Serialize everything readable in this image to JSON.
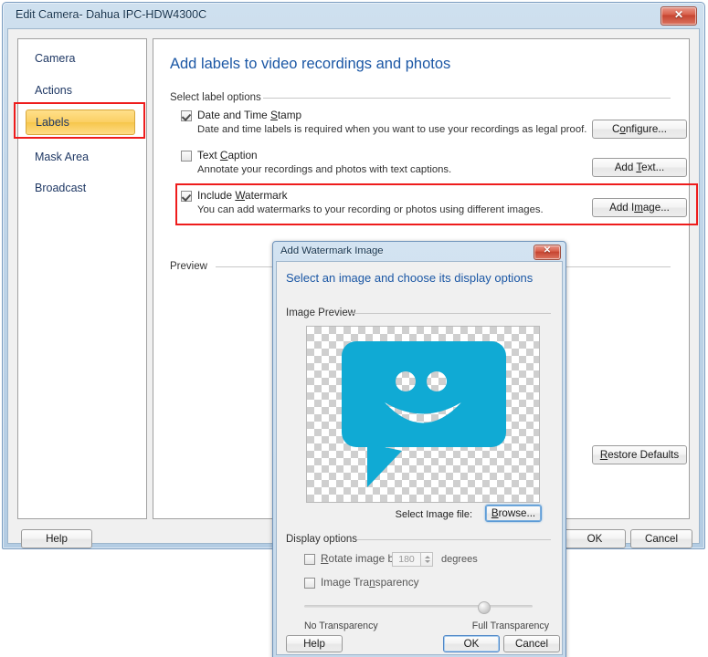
{
  "outer_window": {
    "title": "Edit Camera- Dahua IPC-HDW4300C",
    "close_glyph": "✕",
    "sidebar": {
      "items": [
        {
          "label": "Camera",
          "selected": false
        },
        {
          "label": "Actions",
          "selected": false
        },
        {
          "label": "Labels",
          "selected": true
        },
        {
          "label": "Mask Area",
          "selected": false
        },
        {
          "label": "Broadcast",
          "selected": false
        }
      ]
    },
    "main": {
      "heading": "Add labels to video recordings and photos",
      "group_select_labels": "Select label options",
      "group_preview": "Preview",
      "options": [
        {
          "label_pre": "Date and Time ",
          "label_acc": "S",
          "label_post": "tamp",
          "checked": true,
          "description": "Date and time labels is required when you want to use your recordings as legal proof.",
          "button": {
            "pre": "C",
            "acc": "o",
            "post": "nfigure..."
          }
        },
        {
          "label_pre": "Text ",
          "label_acc": "C",
          "label_post": "aption",
          "checked": false,
          "description": "Annotate your recordings and photos with text captions.",
          "button": {
            "pre": "Add ",
            "acc": "T",
            "post": "ext..."
          }
        },
        {
          "label_pre": "Include ",
          "label_acc": "W",
          "label_post": "atermark",
          "checked": true,
          "description": "You can add watermarks to your recording or photos using different images.",
          "button": {
            "pre": "Add I",
            "acc": "m",
            "post": "age..."
          }
        }
      ],
      "restore_defaults": {
        "pre": "",
        "acc": "R",
        "post": "estore Defaults"
      }
    },
    "footer": {
      "help": "Help",
      "ok": "OK",
      "cancel": "Cancel"
    }
  },
  "inner_dialog": {
    "title": "Add Watermark Image",
    "close_glyph": "✕",
    "heading": "Select an image and choose its display options",
    "group_image_preview": "Image Preview",
    "group_display_options": "Display options",
    "select_image_label": "Select Image file:",
    "browse_button": {
      "pre": "",
      "acc": "B",
      "post": "rowse..."
    },
    "rotate": {
      "checked": false,
      "label_pre": "",
      "label_acc": "R",
      "label_post": "otate image by:",
      "value": "180",
      "unit": "degrees"
    },
    "transparency": {
      "checked": false,
      "label_pre": "Image Tra",
      "label_acc": "n",
      "label_post": "sparency",
      "slider_percent": 80,
      "min_label": "No Transparency",
      "max_label": "Full Transparency"
    },
    "footer": {
      "help": "Help",
      "ok": "OK",
      "cancel": "Cancel"
    }
  },
  "annotations": {
    "highlight_color": "#ee1c1c",
    "selected_nav_color": "#f6c64b"
  },
  "preview_image": {
    "description": "cyan speech bubble with smiley face",
    "bubble_color": "#10aad4"
  }
}
